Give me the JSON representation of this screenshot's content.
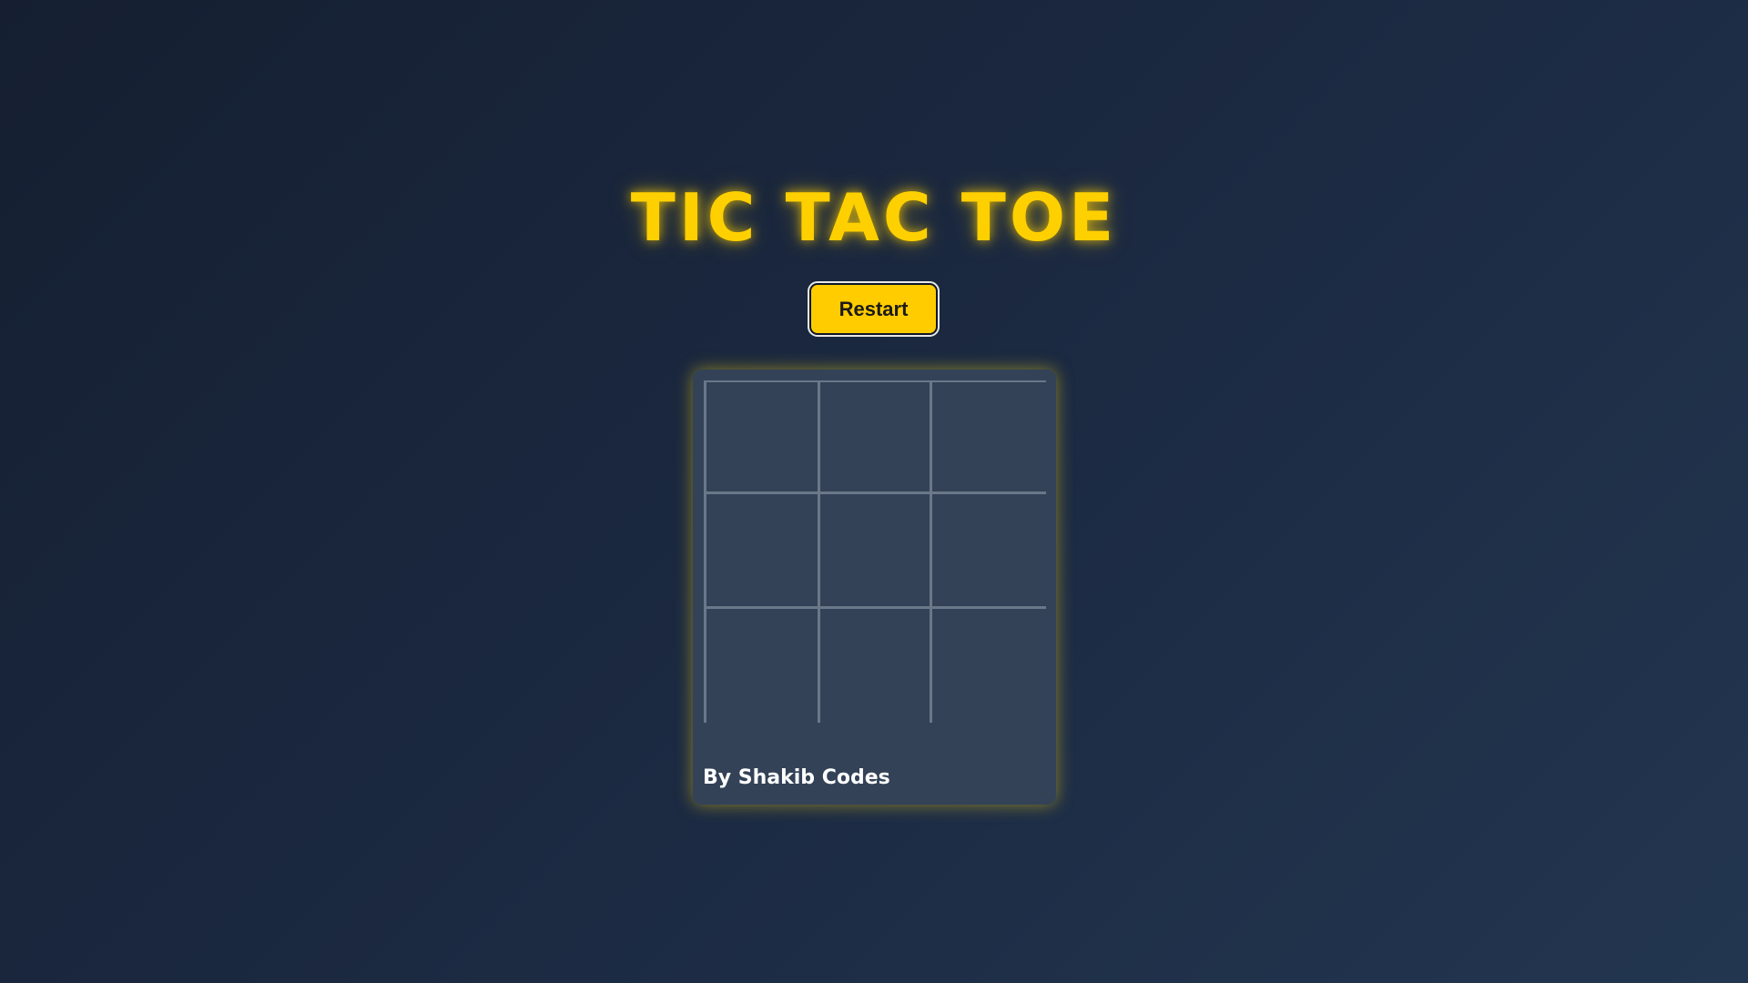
{
  "title": "TIC TAC TOE",
  "restart_label": "Restart",
  "board": {
    "cells": [
      "",
      "",
      "",
      "",
      "",
      "",
      "",
      "",
      ""
    ]
  },
  "credit": "By Shakib Codes",
  "colors": {
    "accent": "#ffd000",
    "background": "#1b2941",
    "panel": "#334257",
    "grid_lines": "#6b7889"
  }
}
